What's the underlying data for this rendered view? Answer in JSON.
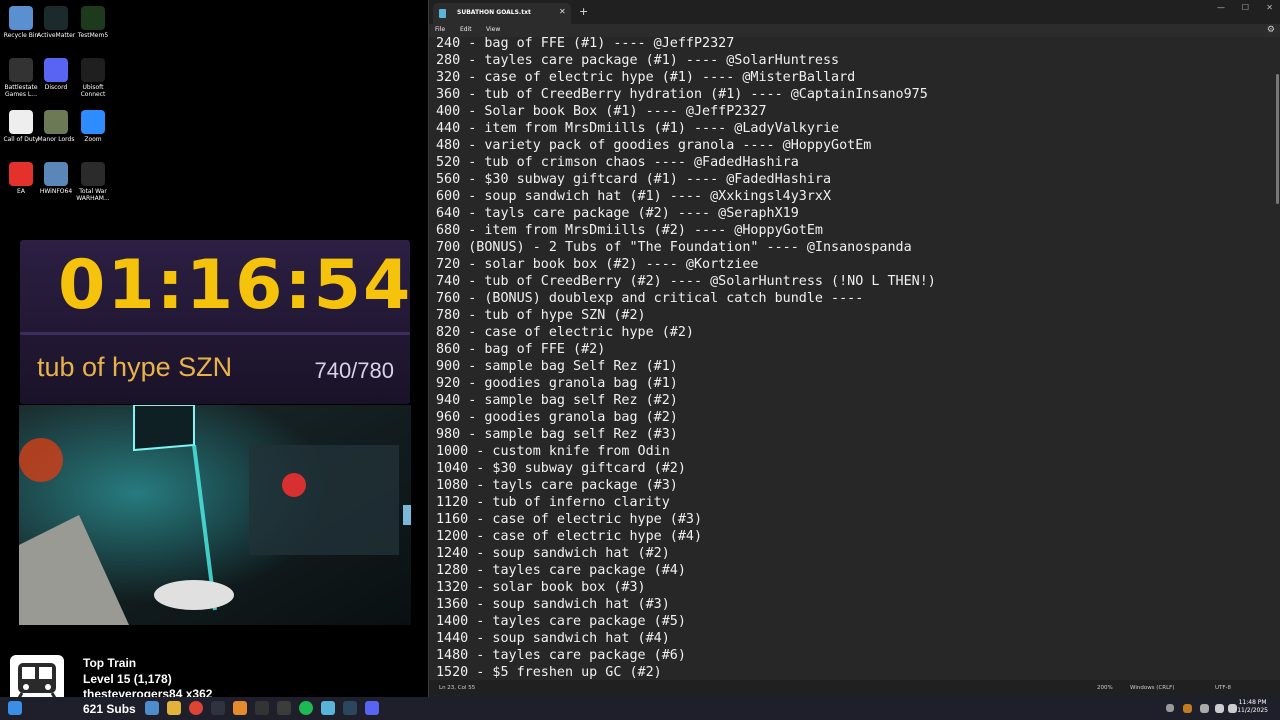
{
  "desktop": {
    "icons": [
      {
        "label": "Recycle Bin",
        "color": "#5a8fd0"
      },
      {
        "label": "ActiveMatter",
        "color": "#1b2a2b"
      },
      {
        "label": "TestMem5",
        "color": "#1d3a1d"
      },
      {
        "label": "Battlestate Games L...",
        "color": "#333333"
      },
      {
        "label": "Discord",
        "color": "#5865f2"
      },
      {
        "label": "Ubisoft Connect",
        "color": "#1f1f1f"
      },
      {
        "label": "Call of Duty",
        "color": "#eeeeee"
      },
      {
        "label": "Manor Lords",
        "color": "#6b7a55"
      },
      {
        "label": "Zoom",
        "color": "#2d8cff"
      },
      {
        "label": "EA",
        "color": "#e5312c"
      },
      {
        "label": "HWiNFO64",
        "color": "#5a87b8"
      },
      {
        "label": "Total War WARHAM...",
        "color": "#2b2b2b"
      }
    ]
  },
  "overlay": {
    "timer": "01:16:54",
    "goal_label": "tub of hype SZN",
    "goal_progress": "740/780"
  },
  "train": {
    "title": "Top Train",
    "level": "Level 15  (1,178)",
    "user": "thesteverogers84 x362",
    "subs": "621 Subs"
  },
  "notepad": {
    "tab_title": "SUBATHON GOALS.txt",
    "menus": [
      "File",
      "Edit",
      "View"
    ],
    "lines": [
      "240 - bag of FFE (#1) ---- @JeffP2327",
      "280 - tayles care package (#1) ---- @SolarHuntress",
      "320 - case of electric hype (#1) ---- @MisterBallard",
      "360 - tub of CreedBerry hydration (#1) ---- @CaptainInsano975",
      "400 - Solar book Box (#1) ---- @JeffP2327",
      "440 - item from MrsDmiills (#1) ---- @LadyValkyrie",
      "480 - variety pack of goodies granola ---- @HoppyGotEm",
      "520 - tub of crimson chaos ---- @FadedHashira",
      "560 - $30 subway giftcard (#1) ---- @FadedHashira",
      "600 - soup sandwich hat (#1) ---- @Xxkingsl4y3rxX",
      "640 - tayls care package (#2) ---- @SeraphX19",
      "680 - item from MrsDmiills (#2) ---- @HoppyGotEm",
      "700 (BONUS) - 2 Tubs of \"The Foundation\" ---- @Insanospanda",
      "720 - solar book box (#2) ---- @Kortziee",
      "740 - tub of CreedBerry (#2) ---- @SolarHuntress (!NO L THEN!)",
      "760 - (BONUS) doublexp and critical catch bundle ----",
      "780 - tub of hype SZN (#2)",
      "820 - case of electric hype (#2)",
      "860 - bag of FFE (#2)",
      "900 - sample bag Self Rez (#1)",
      "920 - goodies granola bag (#1)",
      "940 - sample bag self Rez (#2)",
      "960 - goodies granola bag (#2)",
      "980 - sample bag self Rez (#3)",
      "1000 - custom knife from Odin",
      "1040 - $30 subway giftcard (#2)",
      "1080 - tayls care package (#3)",
      "1120 - tub of inferno clarity",
      "1160 - case of electric hype (#3)",
      "1200 - case of electric hype (#4)",
      "1240 - soup sandwich hat (#2)",
      "1280 - tayles care package (#4)",
      "1320 - solar book box (#3)",
      "1360 - soup sandwich hat (#3)",
      "1400 - tayles care package (#5)",
      "1440 - soup sandwich hat (#4)",
      "1480 - tayles care package (#6)",
      "1520 - $5 freshen up GC (#2)"
    ],
    "status": {
      "position": "Ln 23, Col 55",
      "zoom": "200%",
      "line_ending": "Windows (CRLF)",
      "encoding": "UTF-8"
    }
  },
  "taskbar": {
    "time": "11:48 PM",
    "date": "11/2/2025"
  }
}
